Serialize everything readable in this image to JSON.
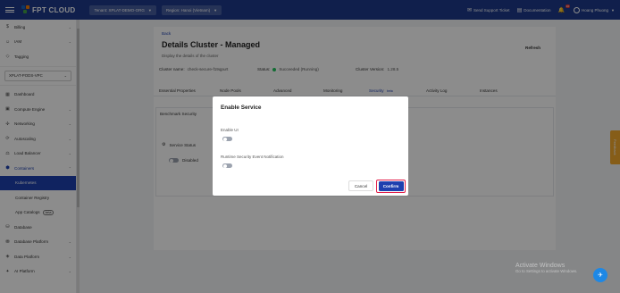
{
  "topbar": {
    "logo_text": "FPT CLOUD",
    "tenant": "Tenant: XPLAT-DEMO-ORG",
    "region": "Region: Hanoi (Vietnam)",
    "support": "Send Support Ticket",
    "documentation": "Documentation",
    "notifications_count": "10",
    "user": "Hoang Phuong"
  },
  "sidebar": {
    "top_items": [
      {
        "label": "Billing",
        "icon": "dollar-icon"
      },
      {
        "label": "IAM",
        "icon": "user-shield-icon"
      },
      {
        "label": "Tagging",
        "icon": "tag-icon"
      }
    ],
    "vpc_select": "XPLAT-PODS-VPC",
    "items": [
      {
        "label": "Dashboard",
        "icon": "dashboard-icon"
      },
      {
        "label": "Compute Engine",
        "icon": "cpu-icon"
      },
      {
        "label": "Networking",
        "icon": "network-icon"
      },
      {
        "label": "Autoscaling",
        "icon": "autoscale-icon"
      },
      {
        "label": "Load Balancer",
        "icon": "load-balancer-icon"
      },
      {
        "label": "Containers",
        "icon": "container-icon"
      },
      {
        "label": "Kubernetes",
        "icon": ""
      },
      {
        "label": "Container Registry",
        "icon": ""
      },
      {
        "label": "App Catalogs",
        "icon": "",
        "badge": "beta"
      },
      {
        "label": "Database",
        "icon": "database-icon"
      },
      {
        "label": "Database Platform",
        "icon": "db-platform-icon"
      },
      {
        "label": "Data Platform",
        "icon": "data-platform-icon"
      },
      {
        "label": "AI Platform",
        "icon": "ai-icon"
      }
    ]
  },
  "main": {
    "back": "Back",
    "title": "Details Cluster - Managed",
    "subtitle": "Display the details of the cluster",
    "refresh": "Refresh",
    "cluster_name_label": "Cluster name:",
    "cluster_name": "check-secure-f19qpurt",
    "status_label": "Status:",
    "status": "Succeeded (Running)",
    "version_label": "Cluster Version:",
    "version": "1.28.5",
    "tabs": [
      "Essential Properties",
      "Node Pools",
      "Advanced",
      "Monitoring",
      "Security",
      "Activity Log",
      "Instances"
    ],
    "security_badge": "beta",
    "benchmark": "Benchmark Security",
    "service_status": "Service Status",
    "disabled": "Disabled"
  },
  "modal": {
    "title": "Enable Service",
    "enable_ui": "Enable UI",
    "runtime": "Runtime Security Event Notification",
    "cancel": "Cancel",
    "confirm": "Confirm"
  },
  "feedback": "Feedback",
  "watermark": {
    "line1": "Activate Windows",
    "line2": "Go to Settings to activate Windows."
  },
  "colors": {
    "brand": "#1e3a8a",
    "accent": "#1e40af",
    "status_green": "#22c55e",
    "highlight": "#e11d48"
  }
}
